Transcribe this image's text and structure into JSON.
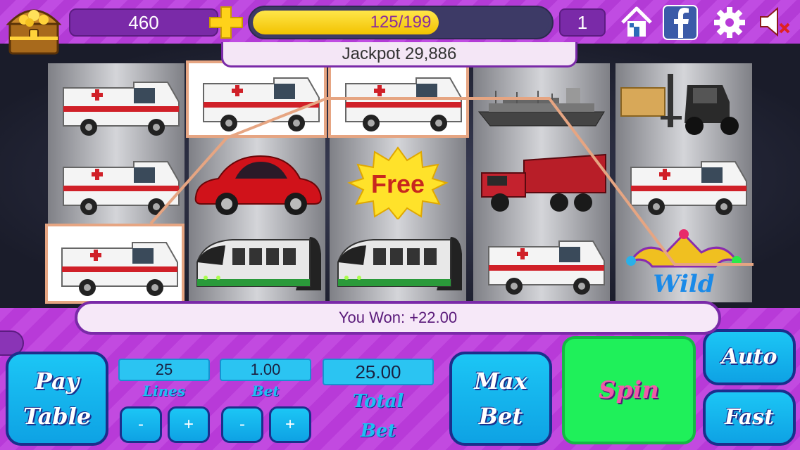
{
  "header": {
    "coins": "460",
    "xp_text": "125/199",
    "xp_progress": 0.628,
    "level": "1",
    "jackpot": "Jackpot 29,886"
  },
  "icons": [
    "treasure-chest-icon",
    "plus-icon",
    "home-icon",
    "facebook-icon",
    "gear-icon",
    "sound-muted-icon"
  ],
  "reels": [
    [
      "ambulance",
      "ambulance",
      "ambulance"
    ],
    [
      "ambulance",
      "red-beetle-car",
      "subway-train"
    ],
    [
      "ambulance",
      "free",
      "subway-train"
    ],
    [
      "cargo-ship",
      "dump-truck",
      "ambulance"
    ],
    [
      "forklift",
      "ambulance",
      "wild-jester"
    ]
  ],
  "symbols": {
    "free_label": "Free",
    "wild_label": "Wild"
  },
  "win": {
    "message": "You Won: +22.00"
  },
  "controls": {
    "pay_table_line1": "Pay",
    "pay_table_line2": "Table",
    "lines_value": "25",
    "lines_label": "Lines",
    "bet_value": "1.00",
    "bet_label": "Bet",
    "total_bet_value": "25.00",
    "total_label_1": "Total",
    "total_label_2": "Bet",
    "minus": "-",
    "plus": "+",
    "max_bet_line1": "Max",
    "max_bet_line2": "Bet",
    "spin": "Spin",
    "auto": "Auto",
    "fast": "Fast"
  },
  "colors": {
    "background_purple": "#b83ad8",
    "button_blue": "#1cc6f5",
    "spin_green": "#1ff05a",
    "payline": "#e6a582"
  }
}
